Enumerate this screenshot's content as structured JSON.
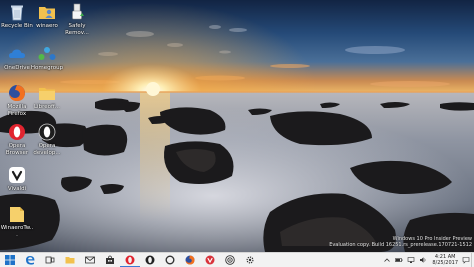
{
  "desktop": {
    "icons": [
      {
        "name": "recycle-bin",
        "label": "Recycle Bin",
        "icon": "recycle-bin-icon"
      },
      {
        "name": "winaero",
        "label": "winaero",
        "icon": "folder-user-icon"
      },
      {
        "name": "safely-remove",
        "label": "Safely\nRemov...",
        "icon": "usb-eject-icon"
      },
      {
        "name": "onedrive",
        "label": "OneDrive",
        "icon": "cloud-icon"
      },
      {
        "name": "homegroup",
        "label": "Homegroup",
        "icon": "homegroup-icon"
      },
      {
        "name": "mozilla-firefox",
        "label": "Mozilla\nFirefox",
        "icon": "firefox-icon"
      },
      {
        "name": "libreoffice",
        "label": "Libreoff...",
        "icon": "folder-icon"
      },
      {
        "name": "opera-browser",
        "label": "Opera\nBrowser",
        "icon": "opera-icon"
      },
      {
        "name": "opera-developer",
        "label": "Opera\ndevelop...",
        "icon": "opera-icon"
      },
      {
        "name": "vivaldi",
        "label": "Vivaldi",
        "icon": "vivaldi-icon"
      },
      {
        "name": "winaero-tweaker",
        "label": "WinaeroTw...",
        "icon": "folder-icon"
      }
    ]
  },
  "watermark": {
    "line1": "Windows 10 Pro Insider Preview",
    "line2": "Evaluation copy. Build 16251.rs_prerelease.170721-1512"
  },
  "taskbar": {
    "buttons": [
      {
        "name": "start-button",
        "icon": "windows-logo-icon"
      },
      {
        "name": "edge-button",
        "icon": "edge-icon"
      },
      {
        "name": "task-view-button",
        "icon": "task-view-icon"
      },
      {
        "name": "file-explorer-button",
        "icon": "folder-icon"
      },
      {
        "name": "mail-button",
        "icon": "mail-icon"
      },
      {
        "name": "store-button",
        "icon": "store-icon"
      },
      {
        "name": "opera-button",
        "icon": "opera-icon"
      },
      {
        "name": "opera-developer-button",
        "icon": "opera-icon"
      },
      {
        "name": "cortana-button",
        "icon": "circle-icon"
      },
      {
        "name": "firefox-button",
        "icon": "firefox-icon"
      },
      {
        "name": "vivaldi-button",
        "icon": "vivaldi-icon"
      },
      {
        "name": "target-app-button",
        "icon": "target-icon"
      },
      {
        "name": "settings-button",
        "icon": "gear-icon"
      }
    ],
    "tray": {
      "time": "4:21 AM",
      "date": "8/25/2017",
      "icons": [
        "chevron-up-icon",
        "battery-icon",
        "network-icon",
        "volume-icon"
      ]
    }
  }
}
